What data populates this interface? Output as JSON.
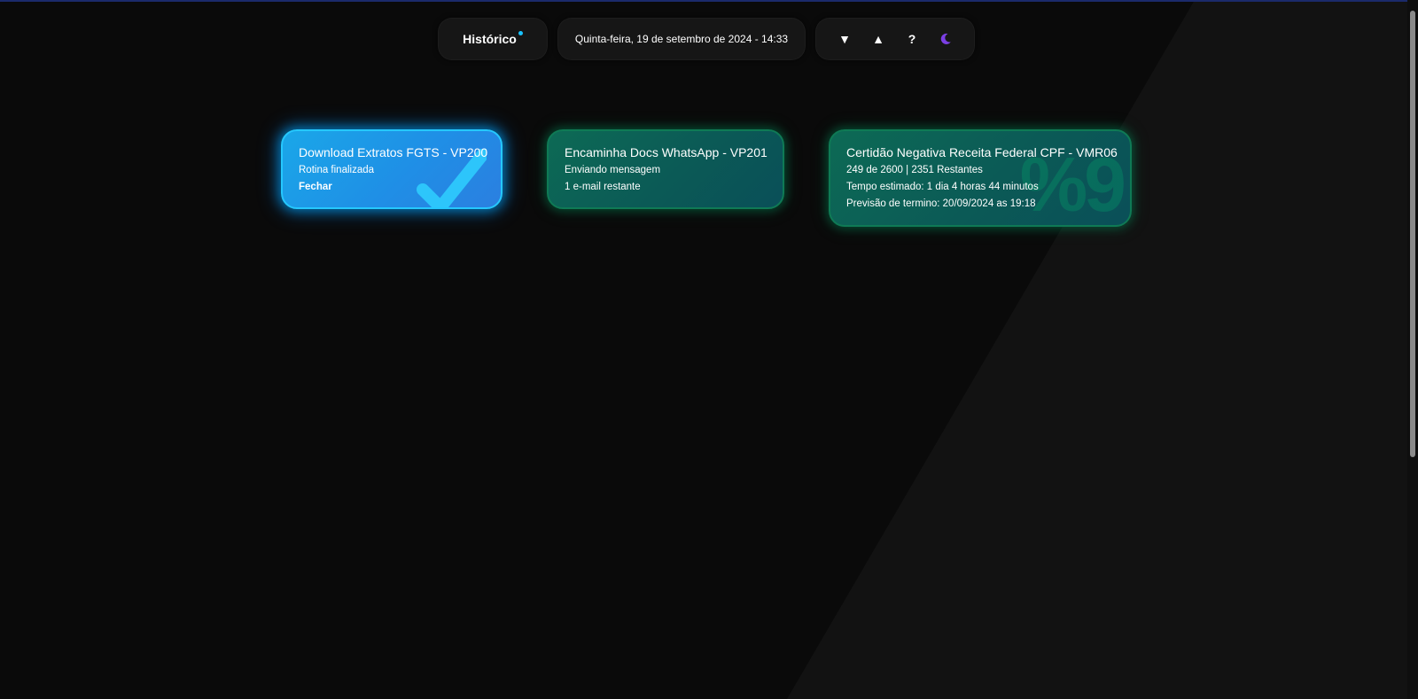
{
  "header": {
    "history_label": "Histórico",
    "datetime": "Quinta-feira, 19 de setembro de 2024 - 14:33",
    "controls": {
      "collapse_icon": "▼",
      "expand_icon": "▲",
      "help_icon": "?",
      "theme_icon": "moon-icon"
    }
  },
  "cards": [
    {
      "title": "Download Extratos FGTS - VP200",
      "status": "Rotina finalizada",
      "action": "Fechar",
      "color": "#1f8fe6"
    },
    {
      "title": "Encaminha Docs WhatsApp - VP201",
      "status": "Enviando mensagem",
      "detail": "1 e-mail restante",
      "color": "#0d6a55"
    },
    {
      "title": "Certidão Negativa Receita Federal CPF - VMR06",
      "progress_text": "249 de 2600 | 2351 Restantes",
      "eta": "Tempo estimado: 1 dia 4 horas 44 minutos",
      "finish": "Previsão de termino: 20/09/2024 as 19:18",
      "watermark": "%9",
      "color": "#0d6a55"
    }
  ],
  "colors": {
    "background": "#0a0a0a",
    "accent_blue": "#19c3ff",
    "theme_icon": "#7b3fe4"
  }
}
